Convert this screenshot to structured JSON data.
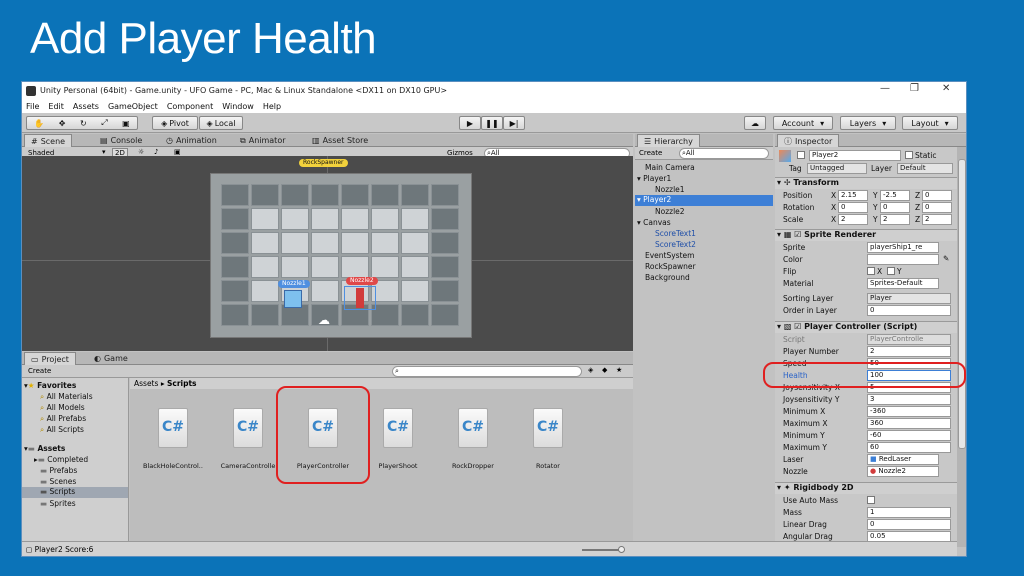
{
  "slide": {
    "title": "Add Player Health"
  },
  "window": {
    "title": "Unity Personal (64bit) - Game.unity - UFO Game - PC, Mac & Linux Standalone <DX11 on DX10 GPU>",
    "controls": {
      "minimize": "—",
      "maximize": "❐",
      "close": "✕"
    }
  },
  "menu": [
    "File",
    "Edit",
    "Assets",
    "GameObject",
    "Component",
    "Window",
    "Help"
  ],
  "toolbar": {
    "pivot": "Pivot",
    "local": "Local",
    "account": "Account",
    "layers": "Layers",
    "layout": "Layout"
  },
  "scene_tabs": [
    "Scene",
    "Console",
    "Animation",
    "Animator",
    "Asset Store"
  ],
  "scene_bar": {
    "shading": "Shaded",
    "mode": "2D",
    "gizmos": "Gizmos",
    "search": "All"
  },
  "scene_labels": {
    "spawner": "RockSpawner",
    "nozzle1": "Nozzle1",
    "nozzle2": "Nozzle2"
  },
  "hierarchy": {
    "tab": "Hierarchy",
    "create": "Create",
    "search": "All",
    "items": [
      {
        "label": "Main Camera"
      },
      {
        "label": "Player1"
      },
      {
        "label": "Nozzle1"
      },
      {
        "label": "Player2"
      },
      {
        "label": "Nozzle2"
      },
      {
        "label": "Canvas"
      },
      {
        "label": "ScoreText1"
      },
      {
        "label": "ScoreText2"
      },
      {
        "label": "EventSystem"
      },
      {
        "label": "RockSpawner"
      },
      {
        "label": "Background"
      }
    ]
  },
  "inspector": {
    "tab": "Inspector",
    "object_name": "Player2",
    "static": "Static",
    "tag_label": "Tag",
    "tag": "Untagged",
    "layer_label": "Layer",
    "layer": "Default",
    "transform": {
      "title": "Transform",
      "position_label": "Position",
      "pos_x": "2.15",
      "pos_y": "-2.5",
      "pos_z": "0",
      "rotation_label": "Rotation",
      "rot_x": "0",
      "rot_y": "0",
      "rot_z": "0",
      "scale_label": "Scale",
      "scl_x": "2",
      "scl_y": "2",
      "scl_z": "2"
    },
    "sprite_renderer": {
      "title": "Sprite Renderer",
      "sprite_label": "Sprite",
      "sprite": "playerShip1_re",
      "color_label": "Color",
      "flip_label": "Flip",
      "flip_x": "X",
      "flip_y": "Y",
      "material_label": "Material",
      "material": "Sprites-Default",
      "sorting_label": "Sorting Layer",
      "sorting": "Player",
      "order_label": "Order in Layer",
      "order": "0"
    },
    "player_controller": {
      "title": "Player Controller (Script)",
      "script_label": "Script",
      "script": "PlayerControlle",
      "player_number_label": "Player Number",
      "player_number": "2",
      "speed_label": "Speed",
      "speed": "50",
      "health_label": "Health",
      "health": "100",
      "joysensitivity_x_label": "Joysensitivity X",
      "joysensitivity_x": "5",
      "joysensitivity_y_label": "Joysensitivity Y",
      "joysensitivity_y": "3",
      "min_x_label": "Minimum X",
      "min_x": "-360",
      "max_x_label": "Maximum X",
      "max_x": "360",
      "min_y_label": "Minimum Y",
      "min_y": "-60",
      "max_y_label": "Maximum Y",
      "max_y": "60",
      "laser_label": "Laser",
      "laser": "RedLaser",
      "nozzle_label": "Nozzle",
      "nozzle": "Nozzle2"
    },
    "rigidbody": {
      "title": "Rigidbody 2D",
      "auto_mass_label": "Use Auto Mass",
      "mass_label": "Mass",
      "mass": "1",
      "linear_drag_label": "Linear Drag",
      "linear_drag": "0",
      "angular_drag_label": "Angular Drag",
      "angular_drag": "0.05"
    }
  },
  "project": {
    "tabs": [
      "Project",
      "Game"
    ],
    "create": "Create",
    "favorites": "Favorites",
    "fav_items": [
      "All Materials",
      "All Models",
      "All Prefabs",
      "All Scripts"
    ],
    "assets": "Assets",
    "asset_folders": [
      "Completed",
      "Prefabs",
      "Scenes",
      "Scripts",
      "Sprites"
    ],
    "breadcrumb": [
      "Assets",
      "Scripts"
    ],
    "scripts": [
      "BlackHoleControl..",
      "CameraControlle",
      "PlayerController",
      "PlayerShoot",
      "RockDropper",
      "Rotator"
    ],
    "cs_glyph": "C#"
  },
  "status": {
    "text": "Player2 Score:6"
  },
  "colors": {
    "highlight_ring": "#e02020",
    "selection": "#3d7fd6",
    "slide_bg": "#0b73b8"
  }
}
